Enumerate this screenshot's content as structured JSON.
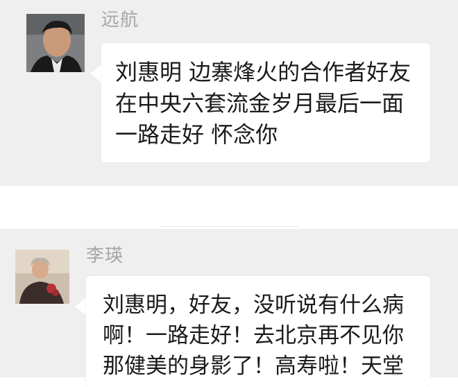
{
  "messages": [
    {
      "sender": "远航",
      "lines": [
        "刘惠明 边寨烽火的合作者好友",
        "在中央六套流金岁月最后一面",
        "一路走好  怀念你"
      ]
    },
    {
      "sender": "李瑛",
      "lines": [
        "刘惠明，好友，没听说有什么病",
        "啊！一路走好！去北京再不见你",
        "那健美的身影了！高寿啦！天堂"
      ]
    }
  ]
}
